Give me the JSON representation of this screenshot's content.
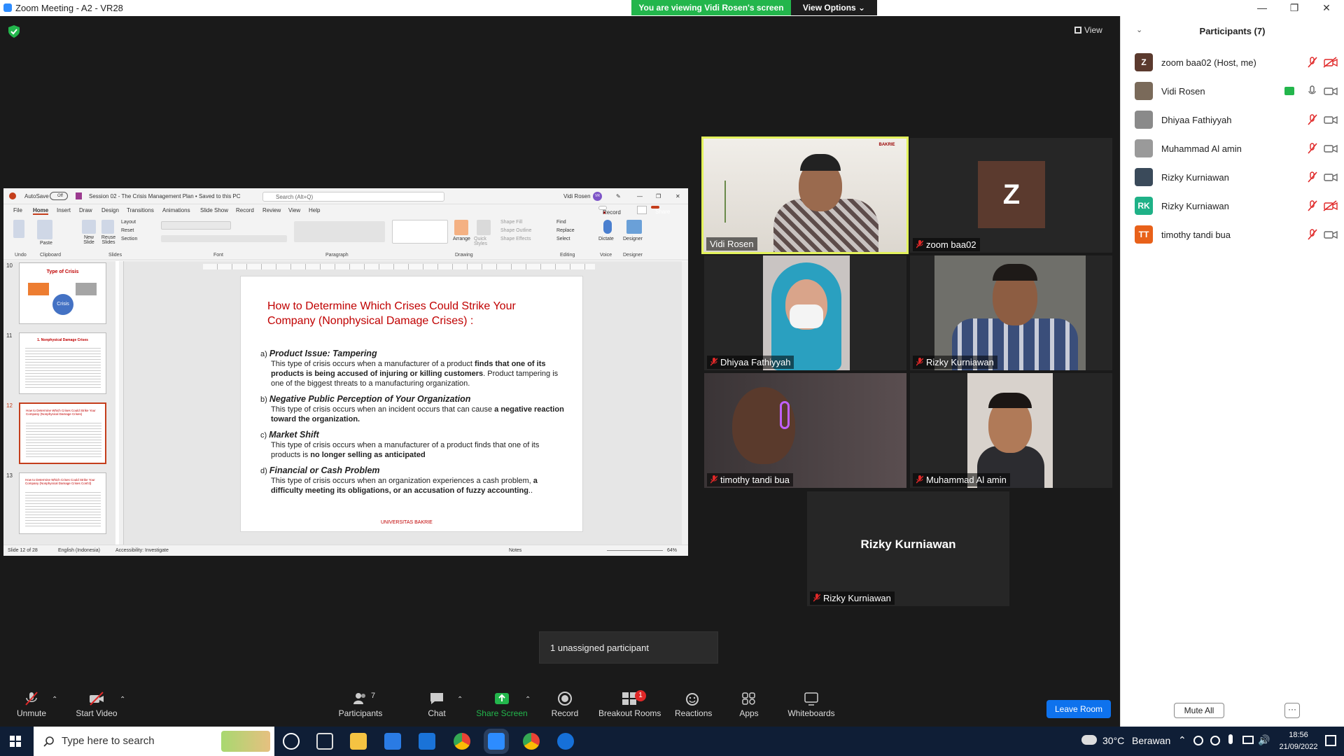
{
  "window": {
    "title": "Zoom Meeting - A2 - VR28"
  },
  "banner": {
    "viewing": "You are viewing Vidi Rosen's screen",
    "view_options": "View Options"
  },
  "view_button": "View",
  "ppt": {
    "autosave": "AutoSave",
    "autosave_state": "Off",
    "doc_title": "Session 02 - The Crisis Management Plan • Saved to this PC",
    "search_placeholder": "Search (Alt+Q)",
    "user": "Vidi Rosen",
    "user_initials": "VR",
    "tabs": [
      "File",
      "Home",
      "Insert",
      "Draw",
      "Design",
      "Transitions",
      "Animations",
      "Slide Show",
      "Record",
      "Review",
      "View",
      "Help"
    ],
    "record_btn": "Record",
    "share_btn": "Share",
    "ribbon_groups": [
      "Undo",
      "Clipboard",
      "Slides",
      "Font",
      "Paragraph",
      "Drawing",
      "Editing",
      "Voice",
      "Designer"
    ],
    "ribbon_labels": {
      "paste": "Paste",
      "new_slide": "New Slide",
      "reuse": "Reuse Slides",
      "layout": "Layout",
      "reset": "Reset",
      "section": "Section",
      "arrange": "Arrange",
      "quick_styles": "Quick Styles",
      "shape_fill": "Shape Fill",
      "shape_outline": "Shape Outline",
      "shape_effects": "Shape Effects",
      "find": "Find",
      "replace": "Replace",
      "select": "Select",
      "dictate": "Dictate",
      "designer": "Designer"
    },
    "thumbs": [
      {
        "num": "10",
        "title": "Type of Crisis",
        "center": "Crisis"
      },
      {
        "num": "11",
        "title": "1. Nonphysical Damage Crises"
      },
      {
        "num": "12",
        "title": "How to Determine Which Crises Could Strike Your Company (Nonphysical Damage Crises)"
      },
      {
        "num": "13",
        "title": "How to Determine Which Crises Could Strike Your Company (Nonphysical Damage Crises Cont'd)"
      }
    ],
    "slide": {
      "title": "How to Determine Which Crises Could Strike Your Company (Nonphysical Damage Crises) :",
      "items": [
        {
          "label": "a)",
          "heading": "Product Issue: Tampering",
          "body_1": "This type of crisis occurs when a manufacturer of a product ",
          "bold_1": "finds that one of its products is being accused of injuring or killing customers",
          "body_2": ". Product tampering is one of the biggest threats to a manufacturing organization."
        },
        {
          "label": "b)",
          "heading": "Negative Public Perception of Your Organization",
          "body_1": "This type of crisis occurs when an incident occurs that can cause ",
          "bold_1": "a negative reaction toward the organization.",
          "body_2": ""
        },
        {
          "label": "c)",
          "heading": "Market Shift",
          "body_1": "This type of crisis occurs when a manufacturer of a product finds that one of its products is ",
          "bold_1": "no longer selling as anticipated",
          "body_2": ""
        },
        {
          "label": "d)",
          "heading": "Financial or Cash Problem",
          "body_1": "This type of crisis occurs when an organization experiences a cash problem, ",
          "bold_1": "a difficulty meeting its obligations, or an accusation of fuzzy accounting",
          "body_2": ".."
        }
      ],
      "footer": "UNIVERSITAS BAKRIE"
    },
    "status": {
      "slide": "Slide 12 of 28",
      "language": "English (Indonesia)",
      "accessibility": "Accessibility: Investigate",
      "notes": "Notes",
      "zoom": "64%"
    }
  },
  "tiles": [
    {
      "name": "Vidi Rosen"
    },
    {
      "name": "zoom baa02",
      "initial": "Z"
    },
    {
      "name": "Dhiyaa Fathiyyah"
    },
    {
      "name": "Rizky Kurniawan"
    },
    {
      "name": "timothy tandi bua"
    },
    {
      "name": "Muhammad Al amin"
    },
    {
      "name": "Rizky Kurniawan",
      "big_name": "Rizky Kurniawan"
    }
  ],
  "unassigned": "1 unassigned participant",
  "toolbar": {
    "unmute": "Unmute",
    "start_video": "Start Video",
    "participants": "Participants",
    "participants_count": "7",
    "chat": "Chat",
    "share_screen": "Share Screen",
    "record": "Record",
    "breakout": "Breakout Rooms",
    "breakout_badge": "1",
    "reactions": "Reactions",
    "apps": "Apps",
    "whiteboards": "Whiteboards",
    "leave": "Leave Room"
  },
  "panel": {
    "title": "Participants (7)",
    "participants": [
      {
        "name": "zoom baa02 (Host, me)",
        "initial": "Z",
        "color": "#5b3a2e",
        "photo": false
      },
      {
        "name": "Vidi Rosen",
        "initial": "",
        "color": "#7a6a5a",
        "photo": true
      },
      {
        "name": "Dhiyaa Fathiyyah",
        "initial": "",
        "color": "#8a8a8a",
        "photo": true
      },
      {
        "name": "Muhammad Al amin",
        "initial": "",
        "color": "#9a9a9a",
        "photo": true
      },
      {
        "name": "Rizky Kurniawan",
        "initial": "",
        "color": "#3a4a5a",
        "photo": true
      },
      {
        "name": "Rizky Kurniawan",
        "initial": "RK",
        "color": "#1fb187",
        "photo": false
      },
      {
        "name": "timothy tandi bua",
        "initial": "TT",
        "color": "#e8611a",
        "photo": false
      }
    ],
    "mute_all": "Mute All",
    "more": "···"
  },
  "taskbar": {
    "search_placeholder": "Type here to search",
    "temp": "30°C",
    "weather": "Berawan",
    "time": "18:56",
    "date": "21/09/2022"
  }
}
